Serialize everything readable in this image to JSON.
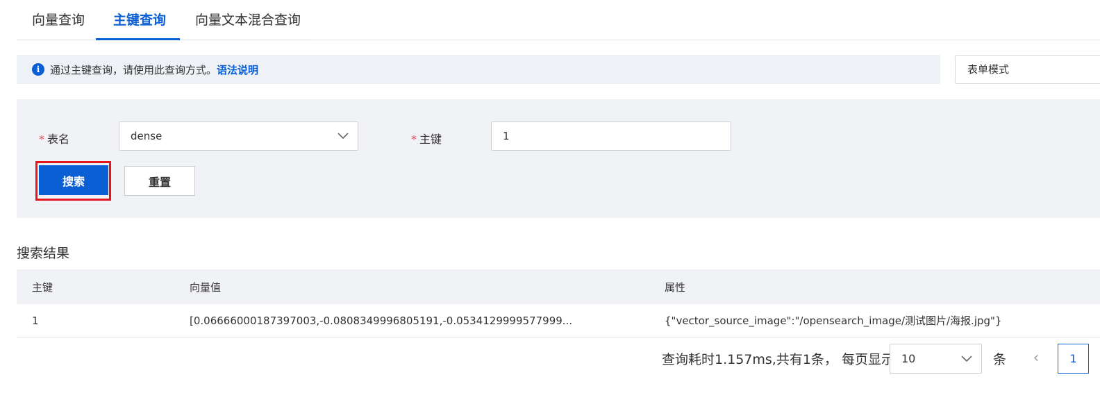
{
  "tabs": [
    {
      "label": "向量查询",
      "active": false
    },
    {
      "label": "主键查询",
      "active": true
    },
    {
      "label": "向量文本混合查询",
      "active": false
    }
  ],
  "info": {
    "text": "通过主键查询，请使用此查询方式。",
    "link": "语法说明"
  },
  "mode_select": {
    "value": "表单模式"
  },
  "form": {
    "table_label": "表名",
    "table_value": "dense",
    "key_label": "主键",
    "key_value": "1",
    "required_mark": "*",
    "search_button": "搜索",
    "reset_button": "重置"
  },
  "results": {
    "title": "搜索结果",
    "columns": [
      "主键",
      "向量值",
      "属性"
    ],
    "rows": [
      [
        "1",
        "[0.06666000187397003,-0.0808349996805191,-0.0534129999577999...",
        "{\"vector_source_image\":\"/opensearch_image/测试图片/海报.jpg\"}"
      ]
    ]
  },
  "pagination": {
    "summary": "查询耗时1.157ms,共有1条，  每页显示",
    "page_size": "10",
    "unit": "条",
    "prev": "‹",
    "current_page": "1"
  },
  "colors": {
    "accent": "#0b5fd4",
    "highlight": "#e4151d",
    "panel": "#f0f2f6"
  }
}
